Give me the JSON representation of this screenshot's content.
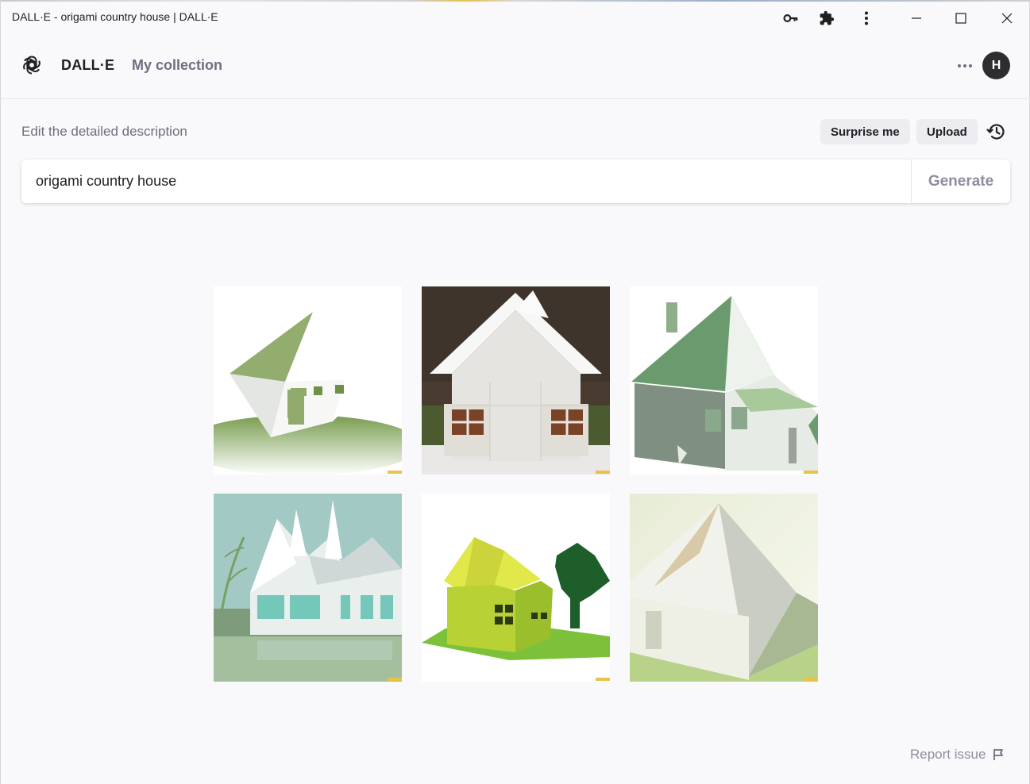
{
  "window": {
    "title": "DALL·E - origami country house | DALL·E"
  },
  "header": {
    "brand": "DALL·E",
    "collection_link": "My collection",
    "avatar_initial": "H"
  },
  "prompt": {
    "label": "Edit the detailed description",
    "surprise_label": "Surprise me",
    "upload_label": "Upload",
    "value": "origami country house",
    "generate_label": "Generate"
  },
  "footer": {
    "report_label": "Report issue"
  },
  "colors": {
    "accent": "#202123",
    "muted": "#6e6e80",
    "background": "#f9f9fb"
  }
}
